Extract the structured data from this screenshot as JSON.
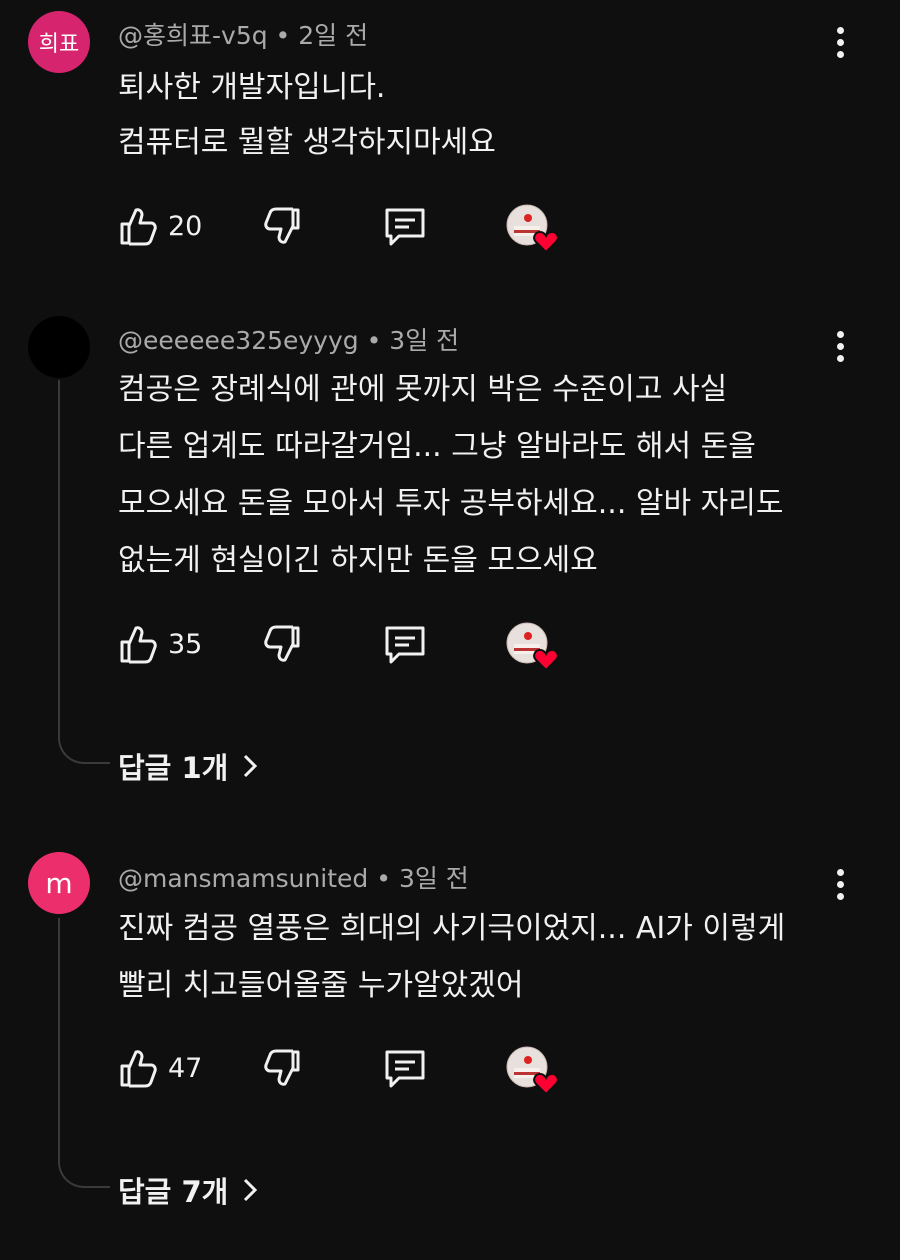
{
  "comments": [
    {
      "avatar_text": "희표",
      "avatar_color": "#d6246e",
      "handle": "@홍희표-v5q",
      "time": "2일 전",
      "lines": [
        "퇴사한 개발자입니다.",
        "컴퓨터로 뭘할 생각하지마세요"
      ],
      "likes": "20"
    },
    {
      "avatar_text": "",
      "avatar_color": "#000000",
      "handle": "@eeeeee325eyyyg",
      "time": "3일 전",
      "lines": [
        "컴공은 장례식에 관에 못까지 박은 수준이고 사실",
        "다른 업계도 따라갈거임... 그냥 알바라도 해서 돈을",
        "모으세요 돈을 모아서 투자 공부하세요... 알바 자리도",
        "없는게 현실이긴 하지만 돈을 모으세요"
      ],
      "likes": "35",
      "replies": "답글 1개"
    },
    {
      "avatar_text": "m",
      "avatar_color": "#ec2f6c",
      "handle": "@mansmamsunited",
      "time": "3일 전",
      "lines": [
        "진짜 컴공 열풍은 희대의 사기극이었지... AI가 이렇게",
        "빨리 치고들어올줄 누가알았겠어"
      ],
      "likes": "47",
      "replies": "답글 7개"
    }
  ],
  "separator": "•",
  "icons": {
    "like": "thumbs-up-icon",
    "dislike": "thumbs-down-icon",
    "reply": "reply-comment-icon",
    "creator_heart": "creator-heart-icon",
    "more": "more-vertical-icon",
    "expand": "chevron-right-icon"
  },
  "colors": {
    "background": "#0f0f0f",
    "heart": "#ff0033",
    "meta": "#aaaaaa"
  }
}
